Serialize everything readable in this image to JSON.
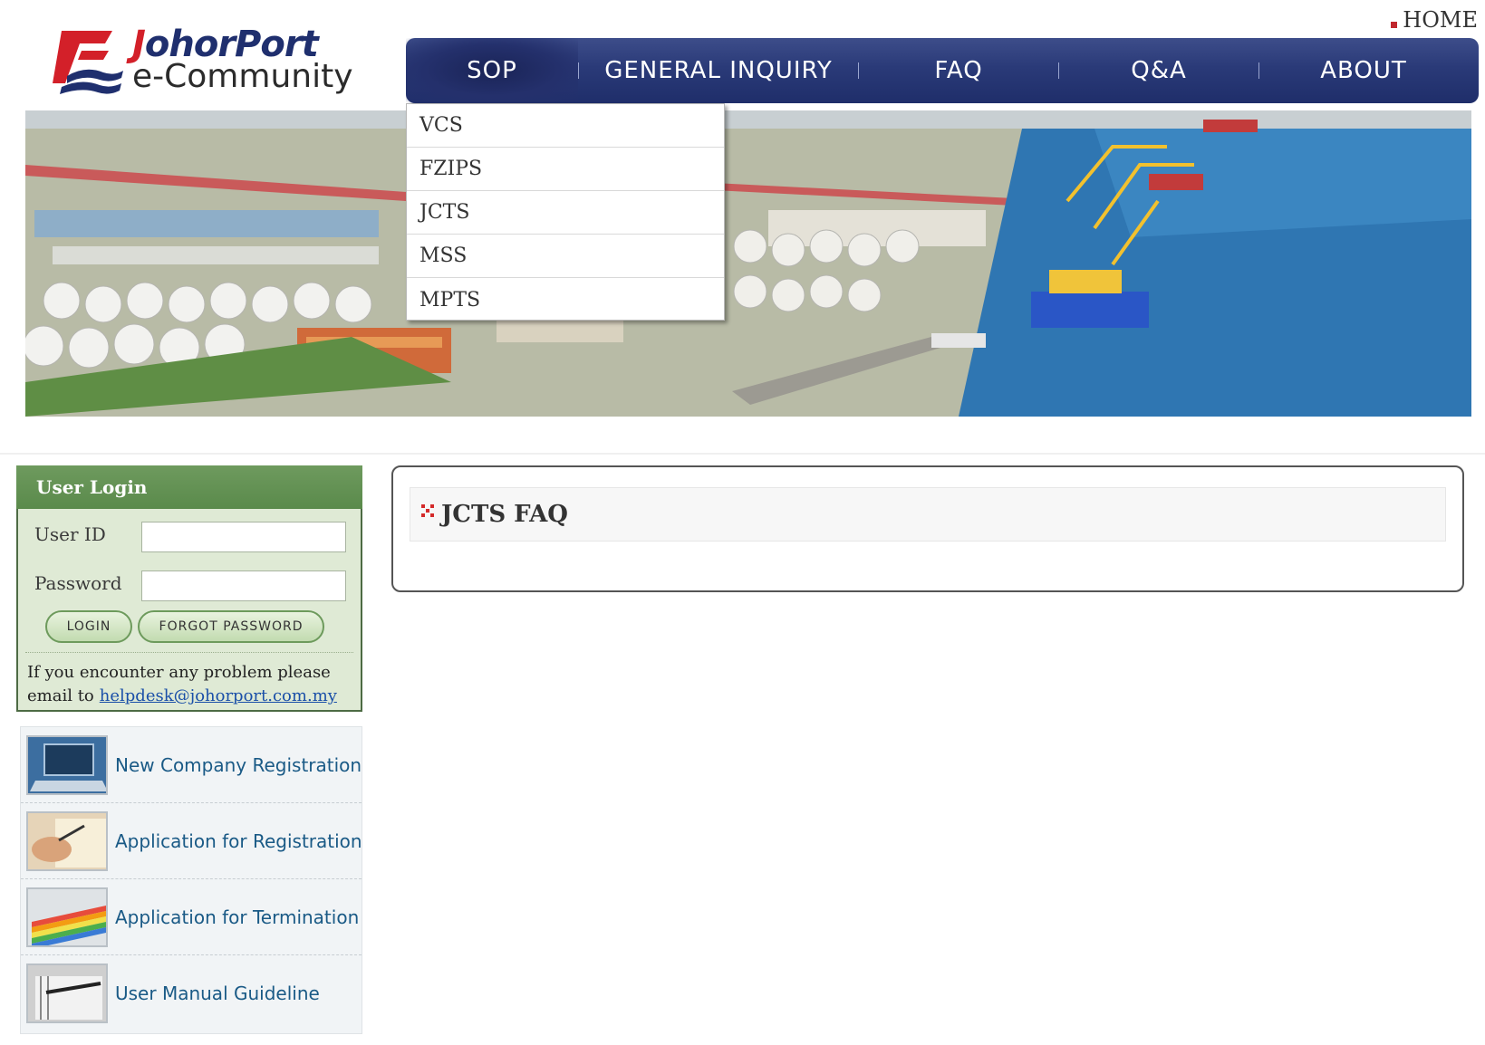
{
  "header": {
    "home_label": "HOME",
    "logo": {
      "brand_part1": "J",
      "brand_part2": "ohorPort",
      "subtitle": "e-Community"
    }
  },
  "nav": {
    "items": [
      {
        "label": "SOP",
        "active": true
      },
      {
        "label": "GENERAL INQUIRY"
      },
      {
        "label": "FAQ"
      },
      {
        "label": "Q&A"
      },
      {
        "label": "ABOUT"
      }
    ],
    "sop_dropdown": [
      "VCS",
      "FZIPS",
      "JCTS",
      "MSS",
      "MPTS"
    ]
  },
  "login": {
    "title": "User Login",
    "user_id_label": "User ID",
    "password_label": "Password",
    "user_id_value": "",
    "password_value": "",
    "login_button": "LOGIN",
    "forgot_button": "FORGOT PASSWORD",
    "help_text": "If you encounter any problem please email to",
    "help_email": "helpdesk@johorport.com.my"
  },
  "quick_links": [
    {
      "label": "New Company Registration",
      "icon": "laptop-icon"
    },
    {
      "label": "Application for Registration",
      "icon": "signing-document-icon"
    },
    {
      "label": "Application for Termination",
      "icon": "colorful-papers-icon"
    },
    {
      "label": "User Manual Guideline",
      "icon": "notebook-pen-icon"
    }
  ],
  "content": {
    "faq_title": "JCTS FAQ"
  },
  "colors": {
    "nav_bg": "#2a3a78",
    "login_header": "#5a8a4b",
    "login_body": "#dfead5",
    "link_blue": "#1a5a86",
    "accent_red": "#d32029"
  }
}
